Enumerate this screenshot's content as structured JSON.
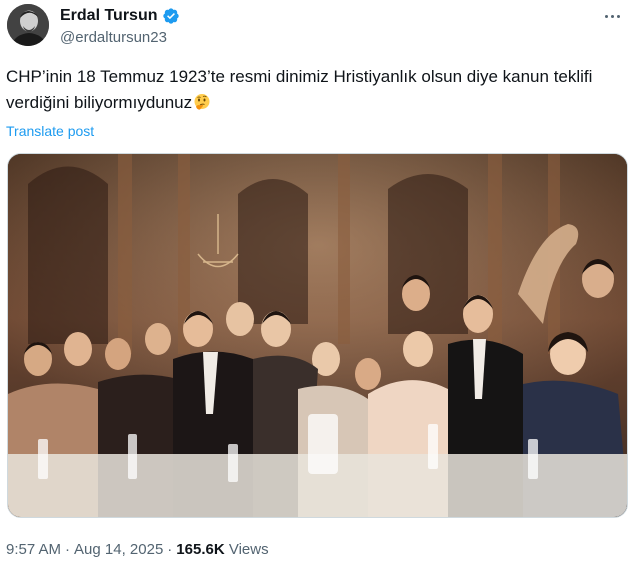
{
  "author": {
    "display_name": "Erdal Tursun",
    "handle": "@erdaltursun23",
    "verified": true,
    "verified_color": "#1d9bf0"
  },
  "tweet": {
    "text": "CHP’inin 18 Temmuz 1923’te resmi dinimiz Hristiyanlık olsun diye kanun teklifi verdiğini biliyormıydunuz",
    "emoji": "thinking-face",
    "translate_label": "Translate post"
  },
  "media": {
    "icon": "photo",
    "colors": {
      "warm": "#7a4a2c",
      "dark": "#2b1a12"
    }
  },
  "meta": {
    "time": "9:57 AM",
    "separator": "·",
    "date": "Aug 14, 2025",
    "views_count": "165.6K",
    "views_label": "Views"
  },
  "colors": {
    "text": "#0f1419",
    "secondary": "#536471",
    "link": "#1d9bf0",
    "border": "#cfd9de"
  }
}
